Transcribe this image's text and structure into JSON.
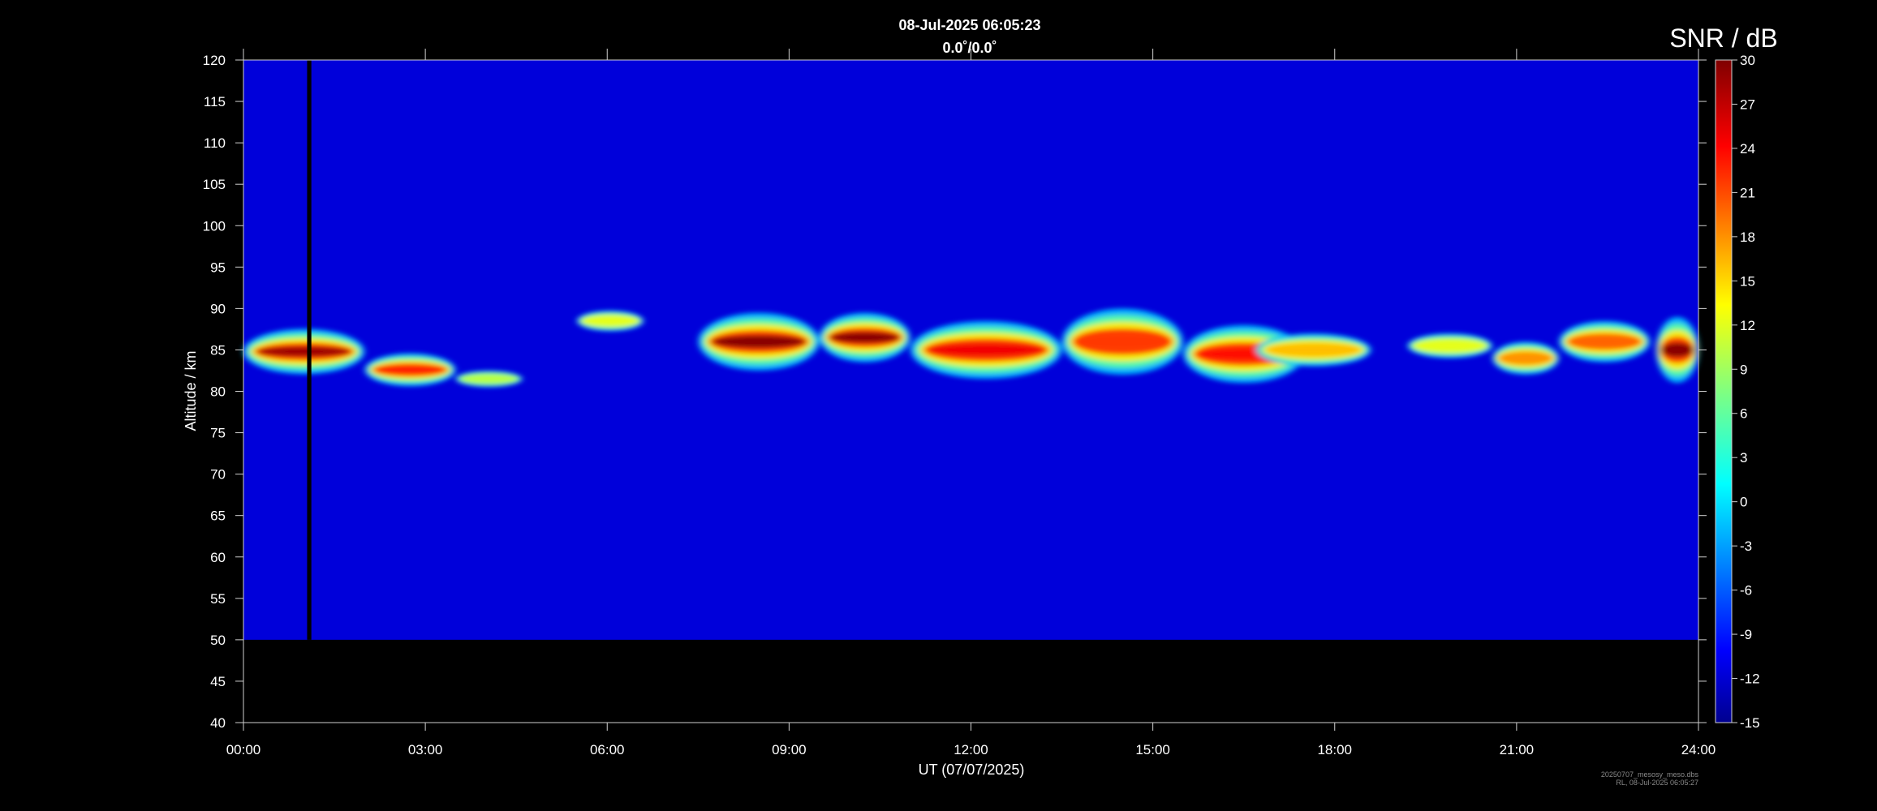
{
  "chart_data": {
    "type": "heatmap",
    "title": "08-Jul-2025 06:05:23",
    "subtitle": "0.0˚/0.0˚",
    "xlabel": "UT (07/07/2025)",
    "ylabel": "Altitude / km",
    "xlim": [
      0,
      24
    ],
    "ylim": [
      40,
      120
    ],
    "x_tick_labels": [
      "00:00",
      "03:00",
      "06:00",
      "09:00",
      "12:00",
      "15:00",
      "18:00",
      "21:00",
      "24:00"
    ],
    "y_ticks": [
      40,
      45,
      50,
      55,
      60,
      65,
      70,
      75,
      80,
      85,
      90,
      95,
      100,
      105,
      110,
      115,
      120
    ],
    "data_altitude_range": [
      50,
      120
    ],
    "data_gap_hours": [
      1.05,
      1.12
    ],
    "colormap": "jet",
    "colorbar": {
      "title": "SNR / dB",
      "range": [
        -15,
        30
      ],
      "ticks": [
        30,
        27,
        24,
        21,
        18,
        15,
        12,
        9,
        6,
        3,
        0,
        -3,
        -6,
        -9,
        -12,
        -15
      ]
    },
    "background_snr": -11,
    "echo_layers": [
      {
        "t_start": 0.0,
        "t_end": 2.0,
        "alt_center": 84.8,
        "thickness": 5.5,
        "peak_snr": 29
      },
      {
        "t_start": 2.0,
        "t_end": 3.5,
        "alt_center": 82.6,
        "thickness": 4.0,
        "peak_snr": 23
      },
      {
        "t_start": 3.5,
        "t_end": 4.6,
        "alt_center": 81.5,
        "thickness": 2.0,
        "peak_snr": 10
      },
      {
        "t_start": 5.5,
        "t_end": 6.6,
        "alt_center": 88.5,
        "thickness": 2.5,
        "peak_snr": 12
      },
      {
        "t_start": 7.5,
        "t_end": 9.5,
        "alt_center": 86.0,
        "thickness": 7.0,
        "peak_snr": 30
      },
      {
        "t_start": 9.5,
        "t_end": 11.0,
        "alt_center": 86.5,
        "thickness": 6.0,
        "peak_snr": 30
      },
      {
        "t_start": 11.0,
        "t_end": 13.5,
        "alt_center": 85.0,
        "thickness": 7.0,
        "peak_snr": 25
      },
      {
        "t_start": 13.5,
        "t_end": 15.5,
        "alt_center": 86.0,
        "thickness": 8.0,
        "peak_snr": 22
      },
      {
        "t_start": 15.5,
        "t_end": 17.5,
        "alt_center": 84.5,
        "thickness": 7.0,
        "peak_snr": 24
      },
      {
        "t_start": 16.7,
        "t_end": 18.6,
        "alt_center": 85.0,
        "thickness": 4.0,
        "peak_snr": 16
      },
      {
        "t_start": 19.2,
        "t_end": 20.6,
        "alt_center": 85.5,
        "thickness": 3.0,
        "peak_snr": 12
      },
      {
        "t_start": 20.6,
        "t_end": 21.7,
        "alt_center": 84.0,
        "thickness": 4.0,
        "peak_snr": 18
      },
      {
        "t_start": 21.7,
        "t_end": 23.2,
        "alt_center": 86.0,
        "thickness": 5.0,
        "peak_snr": 20
      },
      {
        "t_start": 23.3,
        "t_end": 24.0,
        "alt_center": 85.0,
        "thickness": 8.0,
        "peak_snr": 30
      }
    ]
  },
  "footer": {
    "line1": "20250707_mesosy_meso.dbs",
    "line2": "RL, 08-Jul-2025 06:05:27"
  }
}
